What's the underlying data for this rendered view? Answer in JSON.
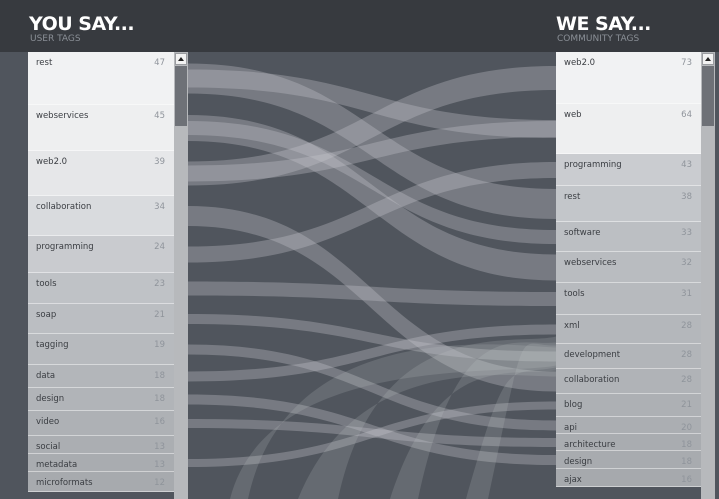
{
  "header": {
    "left_title": "YOU SAY...",
    "left_subtitle": "USER TAGS",
    "right_title": "WE SAY...",
    "right_subtitle": "COMMUNITY TAGS"
  },
  "user_tags": [
    {
      "label": "rest",
      "count": "47"
    },
    {
      "label": "webservices",
      "count": "45"
    },
    {
      "label": "web2.0",
      "count": "39"
    },
    {
      "label": "collaboration",
      "count": "34"
    },
    {
      "label": "programming",
      "count": "24"
    },
    {
      "label": "tools",
      "count": "23"
    },
    {
      "label": "soap",
      "count": "21"
    },
    {
      "label": "tagging",
      "count": "19"
    },
    {
      "label": "data",
      "count": "18"
    },
    {
      "label": "design",
      "count": "18"
    },
    {
      "label": "video",
      "count": "16"
    },
    {
      "label": "social",
      "count": "13"
    },
    {
      "label": "metadata",
      "count": "13"
    },
    {
      "label": "microformats",
      "count": "12"
    }
  ],
  "community_tags": [
    {
      "label": "web2.0",
      "count": "73"
    },
    {
      "label": "web",
      "count": "64"
    },
    {
      "label": "programming",
      "count": "43"
    },
    {
      "label": "rest",
      "count": "38"
    },
    {
      "label": "software",
      "count": "33"
    },
    {
      "label": "webservices",
      "count": "32"
    },
    {
      "label": "tools",
      "count": "31"
    },
    {
      "label": "xml",
      "count": "28"
    },
    {
      "label": "development",
      "count": "28"
    },
    {
      "label": "collaboration",
      "count": "28"
    },
    {
      "label": "blog",
      "count": "21"
    },
    {
      "label": "api",
      "count": "20"
    },
    {
      "label": "architecture",
      "count": "18"
    },
    {
      "label": "design",
      "count": "18"
    },
    {
      "label": "ajax",
      "count": "16"
    }
  ],
  "colors": {
    "background": "#50555d",
    "header": "#373a3f",
    "flow": "#c9cbcf"
  },
  "icons": [
    "scroll-up-arrow-icon"
  ]
}
